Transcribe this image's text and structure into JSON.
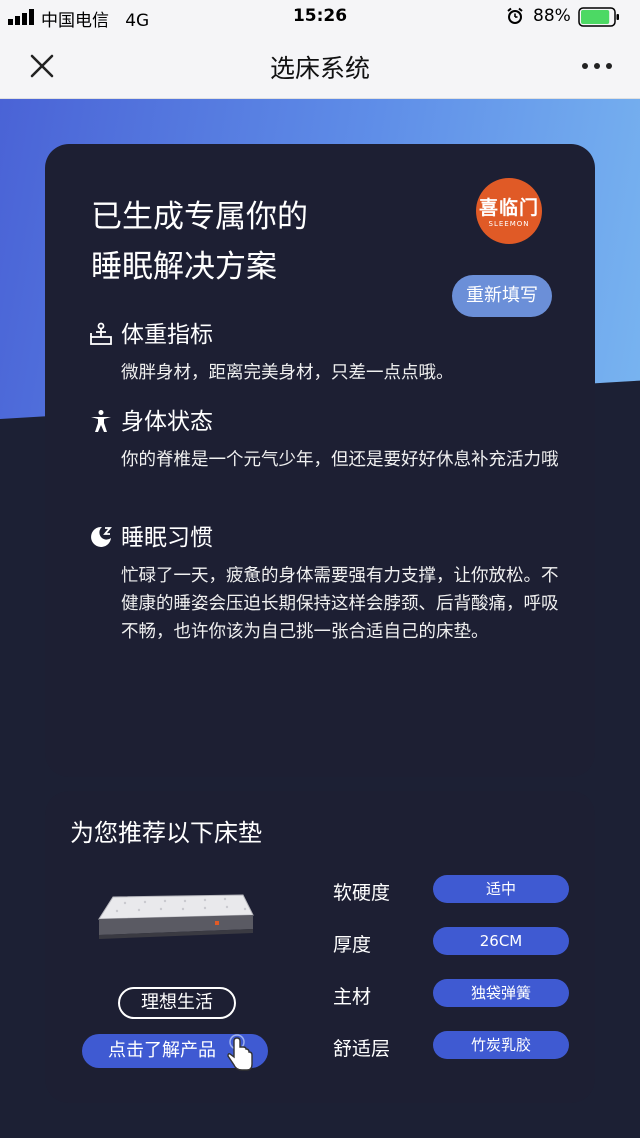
{
  "status_bar": {
    "carrier": "中国电信",
    "network": "4G",
    "time": "15:26",
    "battery_percent": "88%",
    "battery_level": 0.88,
    "battery_color": "#4cd964"
  },
  "nav": {
    "title": "选床系统",
    "close_icon": "close-icon",
    "more_icon": "more-dots-icon"
  },
  "result": {
    "headline_line1": "已生成专属你的",
    "headline_line2": "睡眠解决方案",
    "logo_cn": "喜临门",
    "logo_en": "SLEEMON",
    "refill_label": "重新填写",
    "sections": [
      {
        "icon": "weight-scale-icon",
        "title": "体重指标",
        "text": "微胖身材，距离完美身材，只差一点点哦。"
      },
      {
        "icon": "body-figure-icon",
        "title": "身体状态",
        "text": "你的脊椎是一个元气少年，但还是要好好休息补充活力哦"
      },
      {
        "icon": "sleep-moon-icon",
        "title": "睡眠习惯",
        "text": "忙碌了一天，疲惫的身体需要强有力支撑，让你放松。不健康的睡姿会压迫长期保持这样会脖颈、后背酸痛，呼吸不畅，也许你该为自己挑一张合适自己的床垫。"
      }
    ]
  },
  "recommend": {
    "title": "为您推荐以下床垫",
    "product_name": "理想生活",
    "learn_more_label": "点击了解产品",
    "specs": [
      {
        "label": "软硬度",
        "value": "适中"
      },
      {
        "label": "厚度",
        "value": "26CM"
      },
      {
        "label": "主材",
        "value": "独袋弹簧"
      },
      {
        "label": "舒适层",
        "value": "竹炭乳胶"
      }
    ]
  },
  "colors": {
    "accent_blue": "#3f5ad2",
    "card_bg": "#1d1f33",
    "logo_orange": "#e05a26",
    "refill_blue": "#6b8fd8"
  }
}
